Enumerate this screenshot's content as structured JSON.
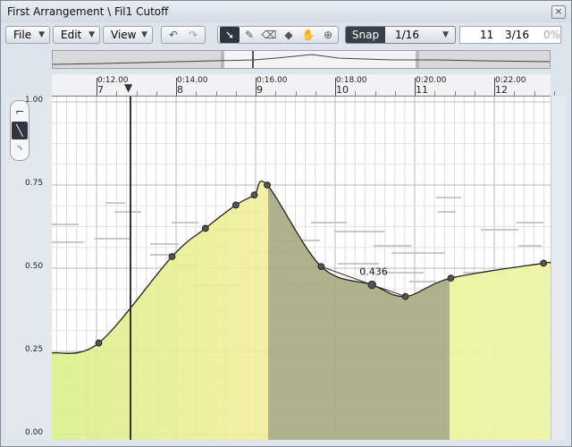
{
  "window": {
    "title": "First Arrangement \\ Fil1 Cutoff",
    "close_label": "×"
  },
  "toolbar": {
    "file_label": "File",
    "edit_label": "Edit",
    "view_label": "View",
    "dropdown_arrow": "▼",
    "undo_icon": "↶",
    "redo_icon": "↷",
    "tools": [
      {
        "name": "arrow-tool-icon",
        "glyph": "➘",
        "active": true
      },
      {
        "name": "draw-tool-icon",
        "glyph": "✎",
        "active": false
      },
      {
        "name": "eraser-tool-icon",
        "glyph": "⌫",
        "active": false
      },
      {
        "name": "paint-tool-icon",
        "glyph": "◆",
        "active": false
      },
      {
        "name": "hand-tool-icon",
        "glyph": "✋",
        "active": false
      },
      {
        "name": "zoom-tool-icon",
        "glyph": "⊕",
        "active": false
      }
    ],
    "snap_label": "Snap",
    "snap_value": "1/16",
    "position_bar": "11",
    "position_beat": "3/16",
    "position_pct": "0%"
  },
  "ruler": {
    "marks": [
      {
        "time": "0:12.00",
        "bar": "7"
      },
      {
        "time": "0:14.00",
        "bar": "8"
      },
      {
        "time": "0:16.00",
        "bar": "9"
      },
      {
        "time": "0:18.00",
        "bar": "10"
      },
      {
        "time": "0:20.00",
        "bar": "11"
      },
      {
        "time": "0:22.00",
        "bar": "12"
      }
    ]
  },
  "curve_tools": [
    {
      "name": "step-shape-icon",
      "glyph": "⌐",
      "active": false
    },
    {
      "name": "linear-shape-icon",
      "glyph": "╲",
      "active": true
    },
    {
      "name": "curve-shape-icon",
      "glyph": "◝",
      "active": false
    }
  ],
  "chart_data": {
    "type": "line",
    "y_ticks": [
      "1.00",
      "0.75",
      "0.50",
      "0.25",
      "0.00"
    ],
    "ylim": [
      0,
      1
    ],
    "value_label": "0.436",
    "points": [
      {
        "x": 0,
        "y": 0.245
      },
      {
        "x": 0.094,
        "y": 0.275
      },
      {
        "x": 0.241,
        "y": 0.535
      },
      {
        "x": 0.308,
        "y": 0.62
      },
      {
        "x": 0.369,
        "y": 0.69
      },
      {
        "x": 0.406,
        "y": 0.72
      },
      {
        "x": 0.432,
        "y": 0.75
      },
      {
        "x": 0.54,
        "y": 0.505
      },
      {
        "x": 0.642,
        "y": 0.45
      },
      {
        "x": 0.709,
        "y": 0.415
      },
      {
        "x": 0.8,
        "y": 0.47
      },
      {
        "x": 0.986,
        "y": 0.515
      }
    ],
    "colors": {
      "fill_light": "#e9f2a5",
      "fill_yellow": "#f5ef96",
      "selection": "#a9ab84",
      "curve": "#222222",
      "grid": "#d0d0d0"
    }
  }
}
